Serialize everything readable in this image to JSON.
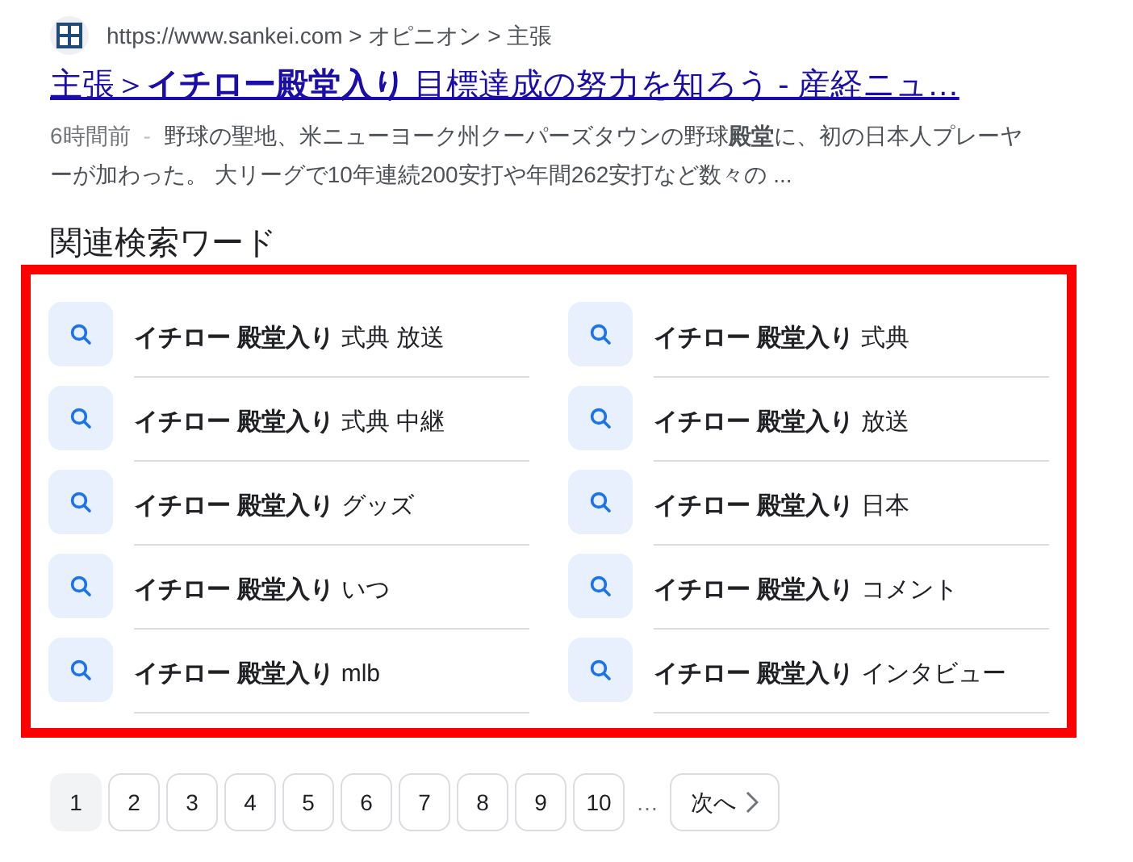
{
  "result": {
    "url": "https://www.sankei.com > オピニオン > 主張",
    "title": "主張＞**イチロー殿堂入り** 目標達成の努力を知ろう - 産経ニュ…",
    "date": "6時間前",
    "separator": "-",
    "snippet": "野球の聖地、米ニューヨーク州クーパーズタウンの野球**殿堂**に、初の日本人プレーヤーが加わった。 大リーグで10年連続200安打や年間262安打など数々の ..."
  },
  "related": {
    "heading": "関連検索ワード",
    "items": [
      {
        "text": "**イチロー 殿堂入り** 式典 放送"
      },
      {
        "text": "**イチロー 殿堂入り** 式典"
      },
      {
        "text": "**イチロー 殿堂入り** 式典 中継"
      },
      {
        "text": "**イチロー 殿堂入り** 放送"
      },
      {
        "text": "**イチロー 殿堂入り** グッズ"
      },
      {
        "text": "**イチロー 殿堂入り** 日本"
      },
      {
        "text": "**イチロー 殿堂入り** いつ"
      },
      {
        "text": "**イチロー 殿堂入り** コメント"
      },
      {
        "text": "**イチロー 殿堂入り** mlb"
      },
      {
        "text": "**イチロー 殿堂入り** インタビュー"
      }
    ]
  },
  "pagination": {
    "pages": [
      {
        "label": "1",
        "selected": true
      },
      {
        "label": "2",
        "selected": false
      },
      {
        "label": "3",
        "selected": false
      },
      {
        "label": "4",
        "selected": false
      },
      {
        "label": "5",
        "selected": false
      },
      {
        "label": "6",
        "selected": false
      },
      {
        "label": "7",
        "selected": false
      },
      {
        "label": "8",
        "selected": false
      },
      {
        "label": "9",
        "selected": false
      },
      {
        "label": "10",
        "selected": false
      }
    ],
    "ellipsis": "…",
    "next": "次へ"
  }
}
